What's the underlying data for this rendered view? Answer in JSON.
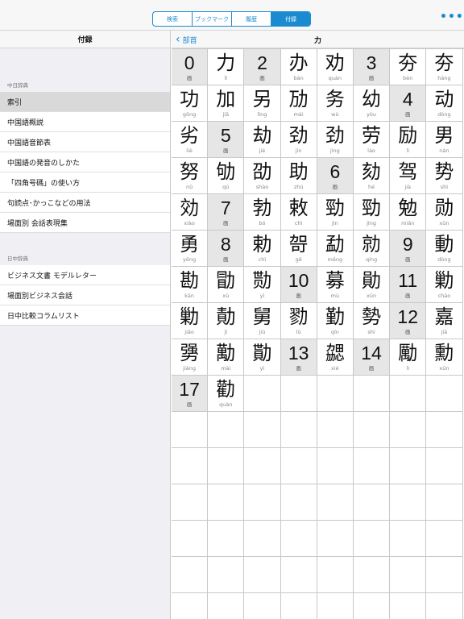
{
  "toolbar": {
    "tabs": [
      {
        "label": "検索",
        "active": false
      },
      {
        "label": "ブックマーク",
        "active": false
      },
      {
        "label": "履歴",
        "active": false
      },
      {
        "label": "付録",
        "active": true
      }
    ],
    "more_icon": "ellipsis-icon",
    "more_glyph": "•••",
    "accent_color": "#1a8ad1"
  },
  "sidebar": {
    "title": "付録",
    "section1": "中日辞典",
    "items1": [
      "索引",
      "中国語概説",
      "中国語音節表",
      "中国語の発音のしかた",
      "「四角号碼」の使い方",
      "句読点･かっこなどの用法",
      "場面別 会話表現集"
    ],
    "selected": "索引",
    "section2": "日中辞典",
    "items2": [
      "ビジネス文書 モデルレター",
      "場面別ビジネス会話",
      "日中比較コラムリスト"
    ]
  },
  "main": {
    "back_label": "部首",
    "back_icon": "chevron-left-icon",
    "back_glyph": "‹",
    "title": "力",
    "cells": [
      {
        "ch": "0",
        "py": "画",
        "header": true
      },
      {
        "ch": "力",
        "py": "lì"
      },
      {
        "ch": "2",
        "py": "画",
        "header": true
      },
      {
        "ch": "办",
        "py": "bàn"
      },
      {
        "ch": "劝",
        "py": "quàn"
      },
      {
        "ch": "3",
        "py": "画",
        "header": true
      },
      {
        "ch": "夯",
        "py": "bèn"
      },
      {
        "ch": "夯",
        "py": "hāng"
      },
      {
        "ch": "功",
        "py": "gōng"
      },
      {
        "ch": "加",
        "py": "jiā"
      },
      {
        "ch": "另",
        "py": "lìng"
      },
      {
        "ch": "劢",
        "py": "mài"
      },
      {
        "ch": "务",
        "py": "wù"
      },
      {
        "ch": "幼",
        "py": "yòu"
      },
      {
        "ch": "4",
        "py": "画",
        "header": true
      },
      {
        "ch": "动",
        "py": "dòng"
      },
      {
        "ch": "劣",
        "py": "liè"
      },
      {
        "ch": "5",
        "py": "画",
        "header": true
      },
      {
        "ch": "劫",
        "py": "jié"
      },
      {
        "ch": "劲",
        "py": "jìn"
      },
      {
        "ch": "劲",
        "py": "jìng"
      },
      {
        "ch": "劳",
        "py": "láo"
      },
      {
        "ch": "励",
        "py": "lì"
      },
      {
        "ch": "男",
        "py": "nán"
      },
      {
        "ch": "努",
        "py": "nǔ"
      },
      {
        "ch": "劬",
        "py": "qú"
      },
      {
        "ch": "劭",
        "py": "shào"
      },
      {
        "ch": "助",
        "py": "zhù"
      },
      {
        "ch": "6",
        "py": "画",
        "header": true
      },
      {
        "ch": "劾",
        "py": "hé"
      },
      {
        "ch": "驾",
        "py": "jià"
      },
      {
        "ch": "势",
        "py": "shì"
      },
      {
        "ch": "効",
        "py": "xiào"
      },
      {
        "ch": "7",
        "py": "画",
        "header": true
      },
      {
        "ch": "勃",
        "py": "bó"
      },
      {
        "ch": "敕",
        "py": "chì"
      },
      {
        "ch": "勁",
        "py": "jìn"
      },
      {
        "ch": "勁",
        "py": "jìng"
      },
      {
        "ch": "勉",
        "py": "miǎn"
      },
      {
        "ch": "勋",
        "py": "xūn"
      },
      {
        "ch": "勇",
        "py": "yǒng"
      },
      {
        "ch": "8",
        "py": "画",
        "header": true
      },
      {
        "ch": "勅",
        "py": "chì"
      },
      {
        "ch": "哿",
        "py": "gě"
      },
      {
        "ch": "勐",
        "py": "měng"
      },
      {
        "ch": "勍",
        "py": "qíng"
      },
      {
        "ch": "9",
        "py": "画",
        "header": true
      },
      {
        "ch": "動",
        "py": "dòng"
      },
      {
        "ch": "勘",
        "py": "kān"
      },
      {
        "ch": "勖",
        "py": "xù"
      },
      {
        "ch": "勚",
        "py": "yì"
      },
      {
        "ch": "10",
        "py": "画",
        "header": true
      },
      {
        "ch": "募",
        "py": "mù"
      },
      {
        "ch": "勛",
        "py": "xūn"
      },
      {
        "ch": "11",
        "py": "画",
        "header": true
      },
      {
        "ch": "勦",
        "py": "chāo"
      },
      {
        "ch": "勦",
        "py": "jiǎo"
      },
      {
        "ch": "勣",
        "py": "jì"
      },
      {
        "ch": "舅",
        "py": "jiù"
      },
      {
        "ch": "勠",
        "py": "lù"
      },
      {
        "ch": "勤",
        "py": "qín"
      },
      {
        "ch": "勢",
        "py": "shì"
      },
      {
        "ch": "12",
        "py": "画",
        "header": true
      },
      {
        "ch": "嘉",
        "py": "jiā"
      },
      {
        "ch": "勥",
        "py": "jiàng"
      },
      {
        "ch": "勱",
        "py": "mài"
      },
      {
        "ch": "勩",
        "py": "yì"
      },
      {
        "ch": "13",
        "py": "画",
        "header": true
      },
      {
        "ch": "勰",
        "py": "xié"
      },
      {
        "ch": "14",
        "py": "画",
        "header": true
      },
      {
        "ch": "勵",
        "py": "lì"
      },
      {
        "ch": "勳",
        "py": "xūn"
      },
      {
        "ch": "17",
        "py": "画",
        "header": true
      },
      {
        "ch": "勸",
        "py": "quàn"
      }
    ]
  }
}
